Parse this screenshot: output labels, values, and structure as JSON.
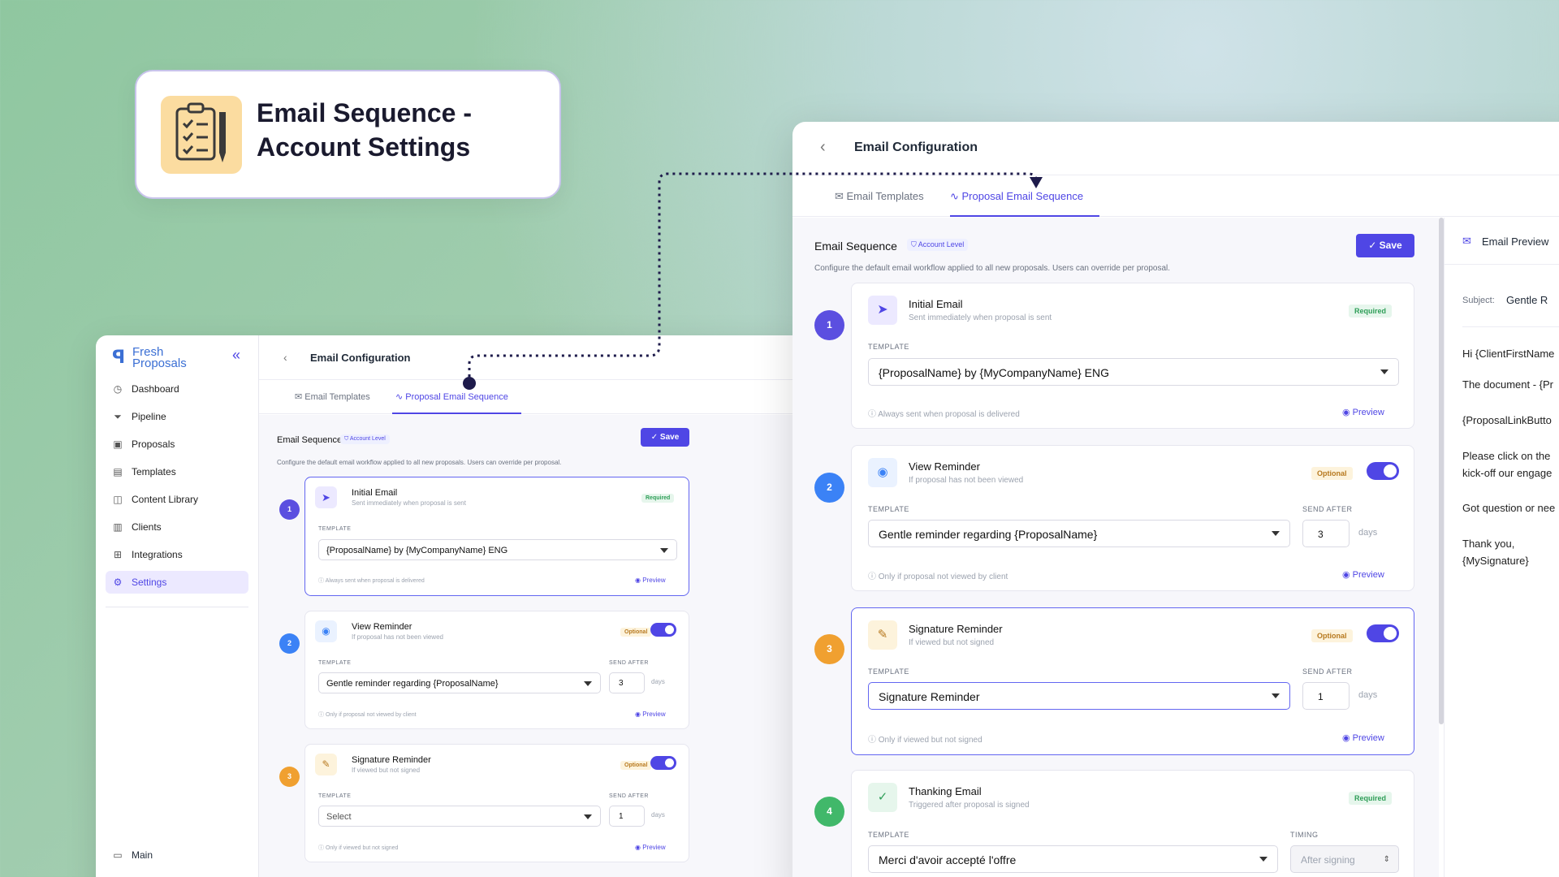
{
  "headline": {
    "title_line1": "Email Sequence -",
    "title_line2": "Account Settings"
  },
  "colors": {
    "accent": "#4f46e5",
    "step1": "#5b4fe0",
    "step2": "#3b82f6",
    "step3": "#f0a030",
    "step4": "#41b86a"
  },
  "sidebar": {
    "brand_line1": "Fresh",
    "brand_line2": "Proposals",
    "items": [
      {
        "label": "Dashboard",
        "icon": "dashboard-icon"
      },
      {
        "label": "Pipeline",
        "icon": "filter-icon"
      },
      {
        "label": "Proposals",
        "icon": "briefcase-icon"
      },
      {
        "label": "Templates",
        "icon": "template-icon"
      },
      {
        "label": "Content Library",
        "icon": "book-icon"
      },
      {
        "label": "Clients",
        "icon": "building-icon"
      },
      {
        "label": "Integrations",
        "icon": "puzzle-icon"
      },
      {
        "label": "Settings",
        "icon": "gear-icon"
      }
    ],
    "footer_label": "Main"
  },
  "page": {
    "title": "Email Configuration",
    "tabs": [
      "Email Templates",
      "Proposal Email Sequence"
    ],
    "section_title": "Email Sequence",
    "badge": "Account Level",
    "save_label": "Save",
    "description": "Configure the default email workflow applied to all new proposals. Users can override per proposal.",
    "template_label": "TEMPLATE",
    "send_after_label": "SEND AFTER",
    "timing_label": "TIMING",
    "days_label": "days",
    "preview_label": "Preview"
  },
  "left_steps": [
    {
      "n": "1",
      "name": "Initial Email",
      "sub": "Sent immediately when proposal is sent",
      "tag": "Required",
      "template": "{ProposalName} by {MyCompanyName} ENG",
      "note": "Always sent when proposal is delivered"
    },
    {
      "n": "2",
      "name": "View Reminder",
      "sub": "If proposal has not been viewed",
      "tag": "Optional",
      "template": "Gentle reminder regarding {ProposalName}",
      "days": "3",
      "note": "Only if proposal not viewed by client"
    },
    {
      "n": "3",
      "name": "Signature Reminder",
      "sub": "If viewed but not signed",
      "tag": "Optional",
      "template": "Select",
      "days": "1",
      "note": "Only if viewed but not signed"
    }
  ],
  "right_steps": [
    {
      "n": "1",
      "name": "Initial Email",
      "sub": "Sent immediately when proposal is sent",
      "tag": "Required",
      "template": "{ProposalName} by {MyCompanyName} ENG",
      "note": "Always sent when proposal is delivered"
    },
    {
      "n": "2",
      "name": "View Reminder",
      "sub": "If proposal has not been viewed",
      "tag": "Optional",
      "template": "Gentle reminder regarding {ProposalName}",
      "days": "3",
      "note": "Only if proposal not viewed by client"
    },
    {
      "n": "3",
      "name": "Signature Reminder",
      "sub": "If viewed but not signed",
      "tag": "Optional",
      "template": "Signature Reminder",
      "days": "1",
      "note": "Only if viewed but not signed"
    },
    {
      "n": "4",
      "name": "Thanking Email",
      "sub": "Triggered after proposal is signed",
      "tag": "Required",
      "template": "Merci d'avoir accepté l'offre",
      "timing": "After signing"
    }
  ],
  "preview": {
    "title": "Email Preview",
    "subject_label": "Subject:",
    "subject_value": "Gentle R",
    "lines": [
      "Hi {ClientFirstName",
      "The document - {Pr",
      "{ProposalLinkButto",
      "Please click on the",
      "kick-off our engage",
      "Got question or nee",
      "Thank you,",
      "{MySignature}"
    ]
  }
}
